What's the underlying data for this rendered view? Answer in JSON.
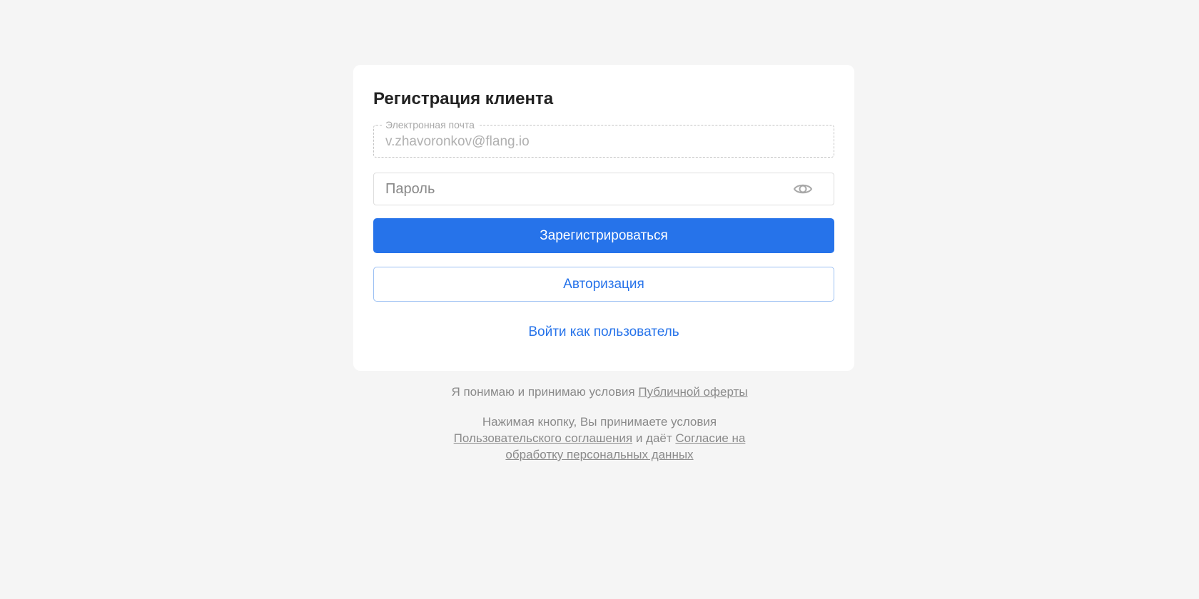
{
  "form": {
    "title": "Регистрация клиента",
    "email_label": "Электронная почта",
    "email_value": "v.zhavoronkov@flang.io",
    "password_placeholder": "Пароль",
    "register_button": "Зарегистрироваться",
    "login_button": "Авторизация",
    "user_login_link": "Войти как пользователь"
  },
  "legal": {
    "offer_text": "Я понимаю и принимаю условия",
    "offer_link": "Публичной оферты",
    "consent_text_start": "Нажимая кнопку, Вы принимаете условия",
    "agreement_link": "Пользовательского соглашения",
    "consent_text_mid": "и даёт",
    "consent_link": "Согласие на обработку персональных данных"
  },
  "icons": {
    "password_toggle": "eye-icon"
  },
  "colors": {
    "accent": "#2673ea",
    "background": "#f5f5f5",
    "card": "#ffffff"
  }
}
